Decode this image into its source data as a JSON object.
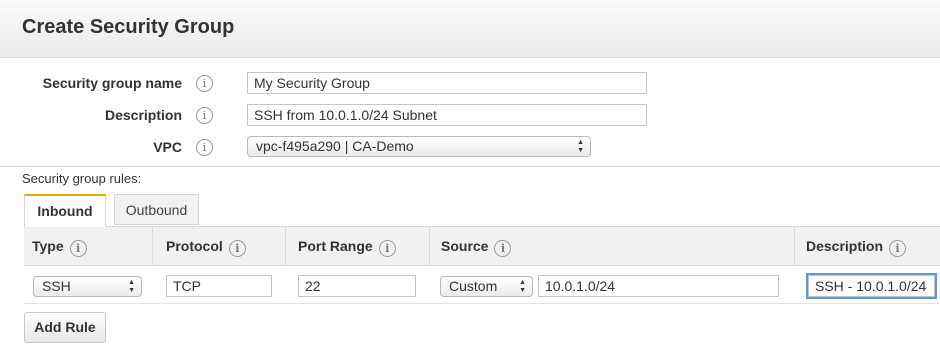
{
  "header": {
    "title": "Create Security Group"
  },
  "form": {
    "name_label": "Security group name",
    "name_value": "My Security Group",
    "description_label": "Description",
    "description_value": "SSH from 10.0.1.0/24 Subnet",
    "vpc_label": "VPC",
    "vpc_value": "vpc-f495a290 | CA-Demo"
  },
  "rules": {
    "section_label": "Security group rules:",
    "tabs": [
      {
        "label": "Inbound",
        "active": true
      },
      {
        "label": "Outbound",
        "active": false
      }
    ],
    "columns": [
      "Type",
      "Protocol",
      "Port Range",
      "Source",
      "Description"
    ],
    "rows": [
      {
        "type": "SSH",
        "protocol": "TCP",
        "port_range": "22",
        "source_type": "Custom",
        "source_value": "10.0.1.0/24",
        "description": "SSH - 10.0.1.0/24"
      }
    ],
    "add_rule_label": "Add Rule"
  },
  "colors": {
    "tab_accent": "#f0a500",
    "focus_outline": "#5a9bd5"
  }
}
